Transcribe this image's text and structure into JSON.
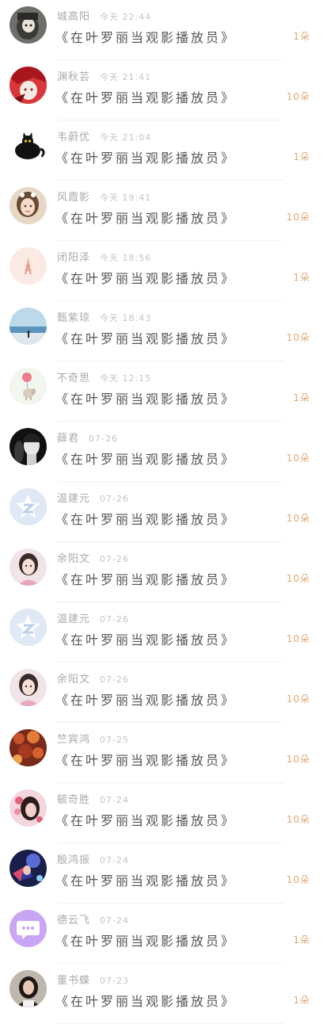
{
  "records": [
    {
      "name": "城高阳",
      "time": "今天 22:44",
      "gift": "《在叶罗丽当观影播放员》",
      "qty": "1朵",
      "avatar": "anime-girl-dark"
    },
    {
      "name": "渊秋芸",
      "time": "今天 21:41",
      "gift": "《在叶罗丽当观影播放员》",
      "qty": "10朵",
      "avatar": "red-anime"
    },
    {
      "name": "韦蔚优",
      "time": "今天 21:04",
      "gift": "《在叶罗丽当观影播放员》",
      "qty": "1朵",
      "avatar": "black-cat-teapot"
    },
    {
      "name": "风霞影",
      "time": "今天 19:41",
      "gift": "《在叶罗丽当观影播放员》",
      "qty": "10朵",
      "avatar": "little-girl"
    },
    {
      "name": "闭阳泽",
      "time": "今天 18:56",
      "gift": "《在叶罗丽当观影播放员》",
      "qty": "1朵",
      "avatar": "eiffel-tower"
    },
    {
      "name": "甄紫琼",
      "time": "今天 18:43",
      "gift": "《在叶罗丽当观影播放员》",
      "qty": "10朵",
      "avatar": "sea-silhouette"
    },
    {
      "name": "不奇思",
      "time": "今天 12:15",
      "gift": "《在叶罗丽当观影播放员》",
      "qty": "1朵",
      "avatar": "balloon-elephant"
    },
    {
      "name": "薛君",
      "time": "07-26",
      "gift": "《在叶罗丽当观影播放员》",
      "qty": "10朵",
      "avatar": "bw-portrait"
    },
    {
      "name": "温建元",
      "time": "07-26",
      "gift": "《在叶罗丽当观影播放员》",
      "qty": "10朵",
      "avatar": "default-star"
    },
    {
      "name": "余阳文",
      "time": "07-26",
      "gift": "《在叶罗丽当观影播放员》",
      "qty": "10朵",
      "avatar": "girl-portrait"
    },
    {
      "name": "温建元",
      "time": "07-26",
      "gift": "《在叶罗丽当观影播放员》",
      "qty": "10朵",
      "avatar": "default-star"
    },
    {
      "name": "余阳文",
      "time": "07-26",
      "gift": "《在叶罗丽当观影播放员》",
      "qty": "10朵",
      "avatar": "girl-portrait"
    },
    {
      "name": "竺宾鸿",
      "time": "07-25",
      "gift": "《在叶罗丽当观影播放员》",
      "qty": "10朵",
      "avatar": "autumn-leaves"
    },
    {
      "name": "毓奇胜",
      "time": "07-24",
      "gift": "《在叶罗丽当观影播放员》",
      "qty": "10朵",
      "avatar": "pink-flower-girl"
    },
    {
      "name": "殷鸿振",
      "time": "07-24",
      "gift": "《在叶罗丽当观影播放员》",
      "qty": "10朵",
      "avatar": "game-character"
    },
    {
      "name": "德云飞",
      "time": "07-24",
      "gift": "《在叶罗丽当观影播放员》",
      "qty": "1朵",
      "avatar": "chat-bubble"
    },
    {
      "name": "董书蝶",
      "time": "07-23",
      "gift": "《在叶罗丽当观影播放员》",
      "qty": "1朵",
      "avatar": "woman-dark"
    }
  ]
}
